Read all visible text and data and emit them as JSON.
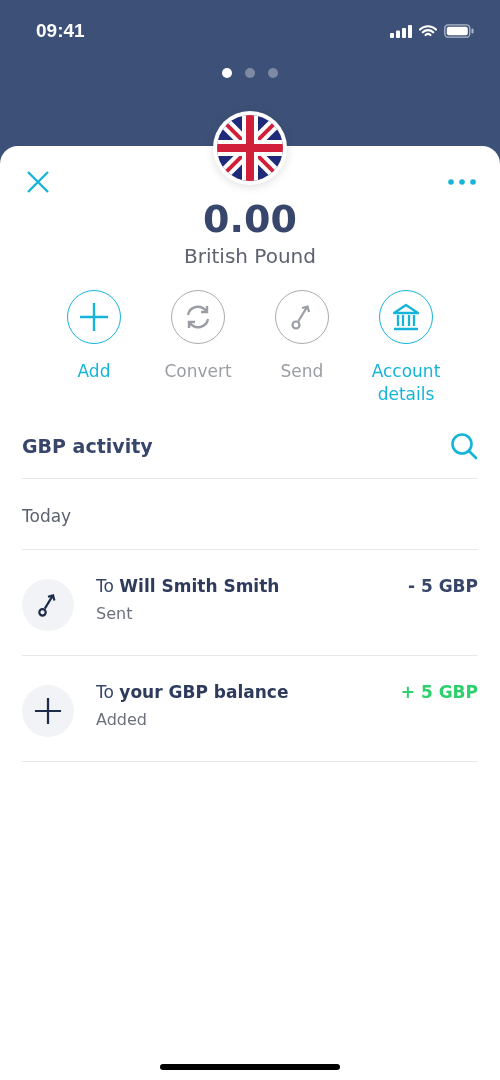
{
  "status_bar": {
    "time": "09:41"
  },
  "page_dots": [
    {
      "selected": true
    },
    {
      "selected": false
    },
    {
      "selected": false
    }
  ],
  "balance": {
    "amount": "0.00",
    "currency": "British Pound"
  },
  "actions": [
    {
      "kind": "add",
      "label": "Add",
      "disabled": false
    },
    {
      "kind": "convert",
      "label": "Convert",
      "disabled": true
    },
    {
      "kind": "send",
      "label": "Send",
      "disabled": true
    },
    {
      "kind": "bank",
      "label": "Account details",
      "disabled": false
    }
  ],
  "activity": {
    "title": "GBP activity",
    "date_group": "Today",
    "transactions": [
      {
        "kind": "sent",
        "title": "To **Will Smith Smith**",
        "status": "Sent",
        "amount": "- 5 GBP"
      },
      {
        "kind": "added",
        "title": "To **your GBP balance**",
        "status": "Added",
        "amount": "+ 5 GBP"
      }
    ]
  }
}
